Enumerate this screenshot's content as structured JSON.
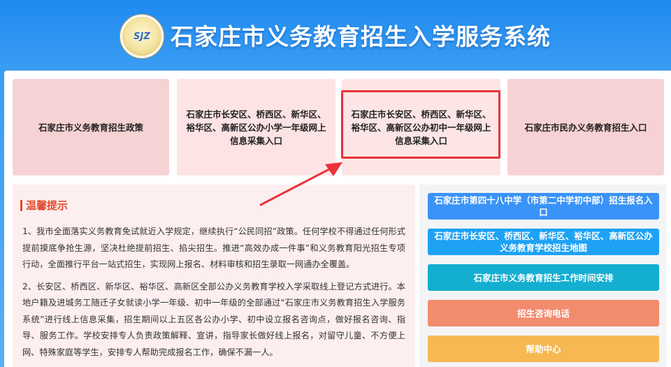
{
  "header": {
    "title": "石家庄市义务教育招生入学服务系统",
    "logo_text": "SJZ"
  },
  "cards": [
    {
      "label": "石家庄市义务教育招生政策"
    },
    {
      "label": "石家庄市长安区、桥西区、新华区、裕华区、高新区公办小学一年级网上信息采集入口"
    },
    {
      "label": "石家庄市长安区、桥西区、新华区、裕华区、高新区公办初中一年级网上信息采集入口"
    },
    {
      "label": "石家庄市民办义务教育招生入口"
    }
  ],
  "notice": {
    "title": "温馨提示",
    "paragraphs": [
      "1、我市全面落实义务教育免试就近入学规定，继续执行“公民同招”政策。任何学校不得通过任何形式提前摸底争抢生源，坚决杜绝提前招生、掐尖招生。推进“高效办成一件事”和义务教育阳光招生专项行动，全面推行平台一站式招生，实现网上报名、材料审核和招生录取一网通办全覆盖。",
      "2、长安区、桥西区、新华区、裕华区、高新区全部公办义务教育学校入学采取线上登记方式进行。本地户籍及进城务工随迁子女就读小学一年级、初中一年级的全部通过“石家庄市义务教育招生入学服务系统”进行线上信息采集，招生期间以上五区各公办小学、初中设立报名咨询点，做好报名咨询、指导、服务工作。学校安排专人负责政策解释、宣讲，指导家长做好线上报名，对留守儿童、不方便上网、特殊家庭等学生，安排专人帮助完成报名工作，确保不漏一人。"
    ]
  },
  "side_buttons": [
    {
      "label": "石家庄市第四十八中学（市第二中学初中部）招生报名入口"
    },
    {
      "label": "石家庄市长安区、桥西区、新华区、裕华区、高新区公办义务教育学校招生地图"
    },
    {
      "label": "石家庄市义务教育招生工作时间安排"
    },
    {
      "label": "招生咨询电话"
    },
    {
      "label": "帮助中心"
    }
  ],
  "colors": {
    "header_blue": "#1f8af0",
    "highlight_red": "#e8323a",
    "notice_title": "#e24a2a",
    "btn_blue": "#3a93f7",
    "btn_sky": "#1ea2f3",
    "btn_teal": "#13aed0",
    "btn_salmon": "#f38b6e",
    "btn_orange": "#f7b853"
  }
}
